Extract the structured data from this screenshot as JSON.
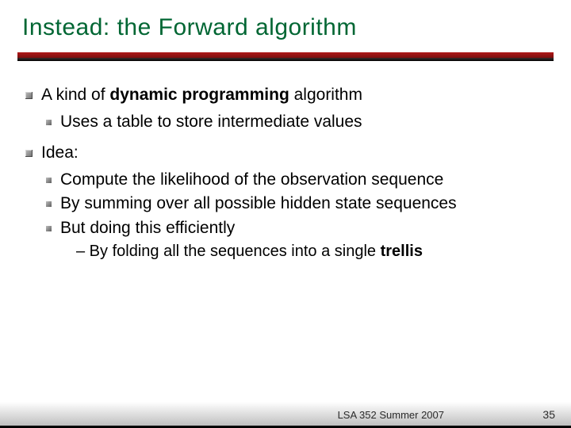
{
  "title": "Instead: the Forward algorithm",
  "bullets": {
    "b1_pre": "A kind of ",
    "b1_bold": "dynamic programming",
    "b1_post": " algorithm",
    "b1_sub1": "Uses a table to store intermediate values",
    "b2": "Idea:",
    "b2_sub1": "Compute the likelihood of the observation sequence",
    "b2_sub2": "By summing over all possible hidden state sequences",
    "b2_sub3": "But doing this efficiently",
    "b2_sub3_dash_pre": "– By folding all the sequences into a single ",
    "b2_sub3_dash_bold": "trellis"
  },
  "footer": {
    "course": "LSA 352 Summer 2007",
    "page": "35"
  }
}
